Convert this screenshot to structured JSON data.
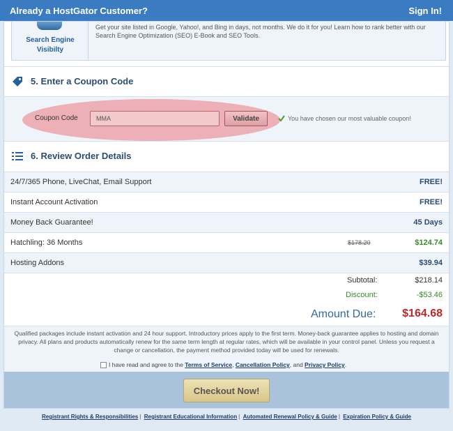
{
  "topbar": {
    "title": "Already a HostGator Customer?",
    "signin": "Sign In!"
  },
  "seo": {
    "label_line1": "Search Engine",
    "label_line2": "Visibilty",
    "text": "Get your site listed in Google, Yahoo!, and Bing in days, not months. We do it for you! Learn how to rank better with our Search Engine Optimization (SEO) E-Book and SEO Tools."
  },
  "coupon": {
    "heading": "5. Enter a Coupon Code",
    "label": "Coupon Code",
    "value": "MMA",
    "validate": "Validate",
    "message": "You have chosen our most valuable coupon!"
  },
  "review": {
    "heading": "6. Review Order Details",
    "rows": [
      {
        "item": "24/7/365 Phone, LiveChat, Email Support",
        "old_price": "",
        "price": "FREE!"
      },
      {
        "item": "Instant Account Activation",
        "old_price": "",
        "price": "FREE!"
      },
      {
        "item": "Money Back Guarantee!",
        "old_price": "",
        "price": "45 Days"
      },
      {
        "item": "Hatchling: 36 Months",
        "old_price": "$178.20",
        "price": "$124.74"
      },
      {
        "item": "Hosting Addons",
        "old_price": "",
        "price": "$39.94"
      }
    ]
  },
  "totals": {
    "subtotal_label": "Subtotal:",
    "subtotal": "$218.14",
    "discount_label": "Discount:",
    "discount": "-$53.46",
    "amount_label": "Amount Due:",
    "amount": "$164.68"
  },
  "disclaimer": "Qualified packages include instant activation and 24 hour support. Introductory prices apply to the first term. Money-back guarantee applies to hosting and domain privacy. All plans and products automatically renew for the same term length at regular rates, which will be available in your control panel. Unless you request a change or cancellation, the payment method provided today will be used for renewals.",
  "agree": {
    "prefix": "I have read and agree to the",
    "tos": "Terms of Service",
    "cancel": "Cancellation Policy",
    "and": ", and",
    "privacy": "Privacy Policy",
    "end": "."
  },
  "checkout": "Checkout Now!",
  "footer": [
    "Registrant Rights & Responsibilities",
    "Registrant Educational Information",
    "Automated Renewal Policy & Guide",
    "Expiration Policy & Guide"
  ],
  "colors": {
    "topbar": "#3a7bc2",
    "amount_due": "#c0262a",
    "discount": "#3a8a2a",
    "highlight": "#ec7880"
  }
}
